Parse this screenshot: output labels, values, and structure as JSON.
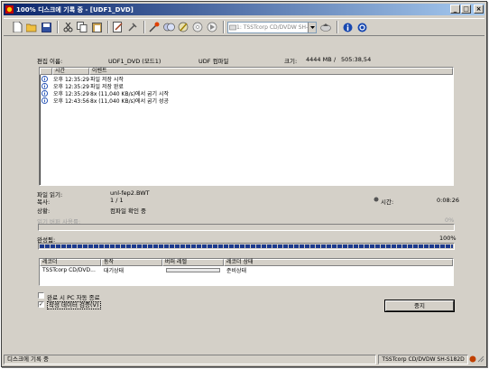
{
  "window": {
    "title": "100% 디스크에 기록 중 - [UDF1_DVD]",
    "controls": {
      "minimize": "_",
      "maximize": "□",
      "close": "×"
    }
  },
  "toolbar": {
    "drive_select": "1: TSSTcorp CD/DVDW SH-S182D",
    "icons": [
      "new-file-icon",
      "open-folder-icon",
      "save-icon",
      "cut-icon",
      "copy-icon",
      "paste-icon",
      "disc-layout-icon",
      "tools-icon",
      "burn-icon",
      "copy-disc-icon",
      "erase-icon",
      "disc-icon",
      "play-icon",
      "eject-icon",
      "info-icon",
      "help-icon"
    ]
  },
  "info": {
    "label_name": "편집 이름:",
    "name_value": "UDF1_DVD (모드1)",
    "format_value": "UDF 컴파일",
    "label_size": "크기:",
    "size_value": "4444 MB",
    "size_sep": "/",
    "size_total": "505:38,54"
  },
  "log": {
    "col_time": "시간",
    "col_event": "이벤트",
    "rows": [
      {
        "time": "오후 12:35:29",
        "event": "파일 저장 시작"
      },
      {
        "time": "오후 12:35:29",
        "event": "파일 저장 완료"
      },
      {
        "time": "오후 12:35:29",
        "event": "8x (11,040 KB/s)에서 굽기 시작"
      },
      {
        "time": "오후 12:43:56",
        "event": "8x (11,040 KB/s)에서 굽기 성공"
      }
    ]
  },
  "status": {
    "label_reading": "파일 읽기:",
    "reading_value": "unl-fep2.BWT",
    "label_copy": "복사:",
    "copy_value": "1 / 1",
    "label_state": "상황:",
    "state_value": "컴파일 확인 중",
    "label_time": "시간:",
    "time_value": "0:08:26",
    "label_read_buffer": "읽기 버퍼 사용률:",
    "read_buffer_pct": "0%",
    "label_complete": "완성됨:",
    "complete_pct": "100%",
    "complete_fraction": 1.0
  },
  "recorder": {
    "col_recorder": "레코더",
    "col_action": "동작",
    "col_buffer": "버퍼 레벨",
    "col_state": "레코더 상태",
    "row": {
      "recorder": "TSSTcorp CD/DVD...",
      "action": "대기상태",
      "state": "준비상태"
    }
  },
  "options": {
    "shutdown_label": "완료 시 PC 자동 종료",
    "shutdown_checked": false,
    "verify_label": "작성 데이터 검증(V)",
    "verify_checked": true
  },
  "stop_button": "중지",
  "statusbar": {
    "left": "디스크에 기록 중",
    "right": "TSSTcorp CD/DVDW SH-S182D"
  }
}
